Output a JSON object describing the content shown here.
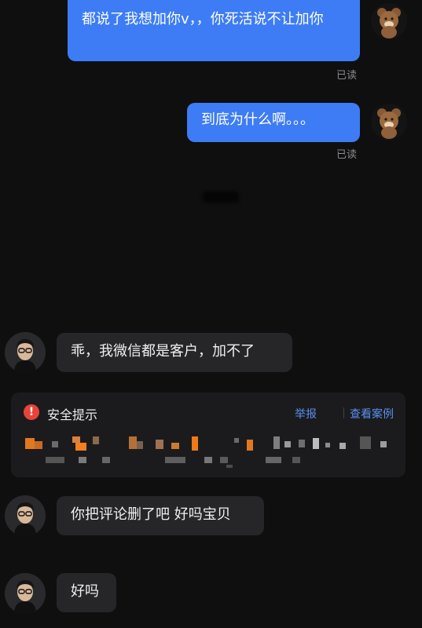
{
  "messages": [
    {
      "side": "sent",
      "text": "都说了我想加你v，，你死活说不让加你",
      "status": "已读"
    },
    {
      "side": "sent",
      "text": "到底为什么啊。。。",
      "status": "已读"
    },
    {
      "side": "received",
      "text": "乖，我微信都是客户，加不了"
    },
    {
      "side": "received",
      "text": "你把评论删了吧 好吗宝贝"
    },
    {
      "side": "received",
      "text": "好吗"
    }
  ],
  "security_notice": {
    "icon": "warning-icon",
    "icon_glyph": "!",
    "title": "安全提示",
    "report_label": "举报",
    "view_cases_label": "查看案例",
    "accent": "#e8443a",
    "link_color": "#5b8ff0"
  },
  "colors": {
    "background": "#0f0f10",
    "sent_bubble": "#3d7cf5",
    "received_bubble": "#262628"
  }
}
